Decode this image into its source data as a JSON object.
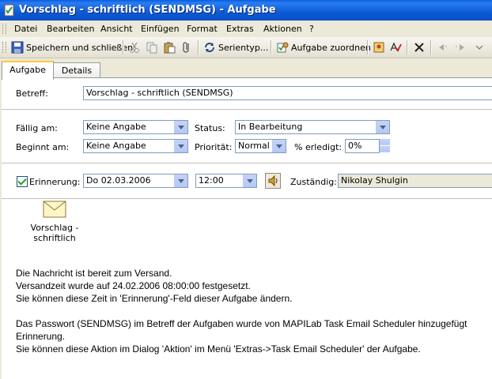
{
  "window": {
    "title": "Vorschlag - schriftlich (SENDMSG) - Aufgabe"
  },
  "menu": [
    "Datei",
    "Bearbeiten",
    "Ansicht",
    "Einfügen",
    "Format",
    "Extras",
    "Aktionen",
    "?"
  ],
  "toolbar": {
    "save_close": "Speichern und schließen",
    "recurrence": "Serientyp...",
    "assign": "Aufgabe zuordnen"
  },
  "tabs": [
    "Aufgabe",
    "Details"
  ],
  "form": {
    "subject_label": "Betreff:",
    "subject_value": "Vorschlag - schriftlich (SENDMSG)",
    "due_label": "Fällig am:",
    "due_value": "Keine Angabe",
    "start_label": "Beginnt am:",
    "start_value": "Keine Angabe",
    "status_label": "Status:",
    "status_value": "In Bearbeitung",
    "priority_label": "Priorität:",
    "priority_value": "Normal",
    "percent_label": "% erledigt:",
    "percent_value": "0%",
    "reminder_label": "Erinnerung:",
    "reminder_date": "Do 02.03.2006",
    "reminder_time": "12:00",
    "owner_label": "Zuständig:",
    "owner_value": "Nikolay Shulgin"
  },
  "attachment": {
    "line1": "Vorschlag -",
    "line2": "schriftlich"
  },
  "body": [
    "Die Nachricht ist bereit zum Versand.",
    "Versandzeit wurde auf 24.02.2006 08:00:00 festgesetzt.",
    "Sie können diese Zeit in 'Erinnerung'-Feld dieser Aufgabe ändern.",
    "Das Passwort (SENDMSG) im Betreff der Aufgaben wurde von MAPILab Task Email Scheduler hinzugefügt",
    "Erinnerung.",
    "Sie können diese Aktion im Dialog 'Aktion' im Menü 'Extras->Task Email Scheduler' der Aufgabe."
  ]
}
